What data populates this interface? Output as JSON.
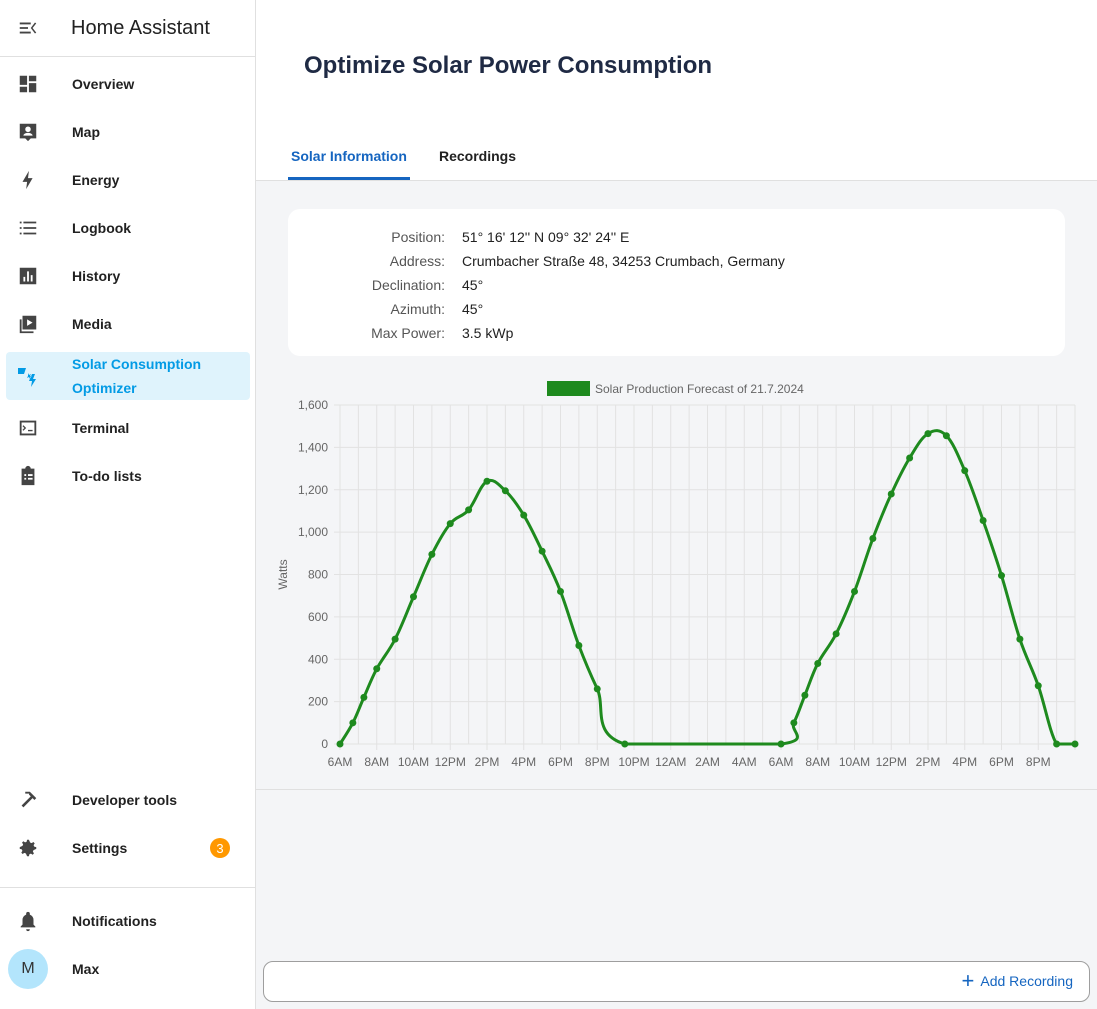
{
  "app": {
    "title": "Home Assistant"
  },
  "sidebar": {
    "items": [
      {
        "label": "Overview",
        "icon": "overview-icon"
      },
      {
        "label": "Map",
        "icon": "map-icon"
      },
      {
        "label": "Energy",
        "icon": "energy-icon"
      },
      {
        "label": "Logbook",
        "icon": "logbook-icon"
      },
      {
        "label": "History",
        "icon": "history-icon"
      },
      {
        "label": "Media",
        "icon": "media-icon"
      },
      {
        "label": "Solar Consumption Optimizer",
        "icon": "solar-optimizer-icon",
        "active": true
      },
      {
        "label": "Terminal",
        "icon": "terminal-icon"
      },
      {
        "label": "To-do lists",
        "icon": "todo-icon"
      }
    ],
    "developer_tools": "Developer tools",
    "settings": "Settings",
    "settings_badge": "3",
    "notifications": "Notifications",
    "user_name": "Max",
    "user_initial": "M"
  },
  "page": {
    "title": "Optimize Solar Power Consumption",
    "tabs": [
      "Solar Information",
      "Recordings"
    ],
    "active_tab": "Solar Information"
  },
  "solar_info": {
    "position_label": "Position:",
    "position": "51° 16' 12'' N 09° 32' 24'' E",
    "address_label": "Address:",
    "address": "Crumbacher Straße 48, 34253 Crumbach, Germany",
    "declination_label": "Declination:",
    "declination": "45°",
    "azimuth_label": "Azimuth:",
    "azimuth": "45°",
    "max_power_label": "Max Power:",
    "max_power": "3.5 kWp"
  },
  "chart_data": {
    "type": "line",
    "legend": "Solar Production Forecast of 21.7.2024",
    "legend_position": "top",
    "ylabel": "Watts",
    "ylim": [
      0,
      1600
    ],
    "yticks": [
      "0",
      "200",
      "400",
      "600",
      "800",
      "1,000",
      "1,200",
      "1,400",
      "1,600"
    ],
    "xticks": [
      "6AM",
      "8AM",
      "10AM",
      "12PM",
      "2PM",
      "4PM",
      "6PM",
      "8PM",
      "10PM",
      "12AM",
      "2AM",
      "4AM",
      "6AM",
      "8AM",
      "10AM",
      "12PM",
      "2PM",
      "4PM",
      "6PM",
      "8PM"
    ],
    "x_hours": [
      0,
      0.7,
      1.3,
      2.0,
      3.0,
      4.0,
      5.0,
      6.0,
      7.0,
      8.0,
      9.0,
      10.0,
      11.0,
      12.0,
      13.0,
      14.0,
      15.5,
      24.0,
      24.7,
      25.3,
      26.0,
      27.0,
      28.0,
      29.0,
      30.0,
      31.0,
      32.0,
      33.0,
      34.0,
      35.0,
      36.0,
      37.0,
      38.0,
      39.0,
      40.0
    ],
    "values": [
      0,
      100,
      220,
      355,
      495,
      695,
      895,
      1040,
      1105,
      1240,
      1195,
      1080,
      910,
      720,
      465,
      260,
      0,
      0,
      100,
      230,
      380,
      520,
      720,
      970,
      1180,
      1350,
      1465,
      1455,
      1290,
      1055,
      795,
      495,
      275,
      0,
      0
    ],
    "series_color": "#1e8a1e",
    "grid": true
  },
  "bottom_bar": {
    "add_recording": "Add Recording"
  }
}
